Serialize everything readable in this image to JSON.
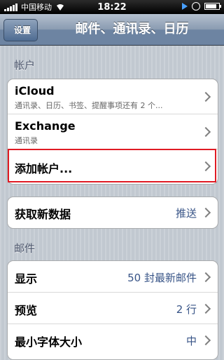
{
  "status_bar": {
    "carrier": "中国移动",
    "time": "18:22",
    "icons": [
      "signal-icon",
      "wifi-icon",
      "play-icon",
      "orientation-lock-icon",
      "battery-icon"
    ],
    "battery_level": 0.85
  },
  "nav": {
    "back_label": "设置",
    "title": "邮件、通讯录、日历"
  },
  "sections": {
    "accounts_header": "帐户",
    "accounts": [
      {
        "title": "iCloud",
        "subtitle": "通讯录、日历、书签、提醒事项还有 2 个..."
      },
      {
        "title": "Exchange",
        "subtitle": "通讯录"
      },
      {
        "title": "添加帐户..."
      }
    ],
    "fetch": {
      "title": "获取新数据",
      "value": "推送"
    },
    "mail_header": "邮件",
    "mail": [
      {
        "title": "显示",
        "value": "50 封最新邮件"
      },
      {
        "title": "预览",
        "value": "2 行"
      },
      {
        "title": "最小字体大小",
        "value": "中"
      }
    ]
  },
  "colors": {
    "accent_value": "#385487",
    "highlight_border": "#e01b24"
  }
}
